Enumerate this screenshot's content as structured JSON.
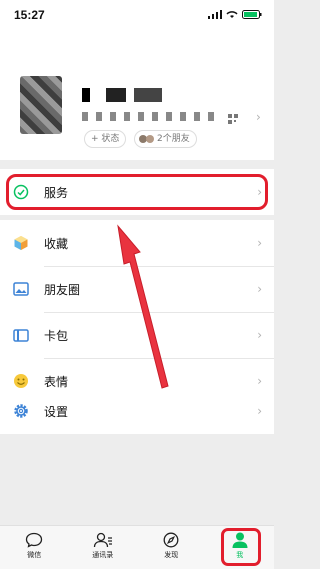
{
  "status_bar": {
    "time": "15:27"
  },
  "profile": {
    "status_button": "+ 状态",
    "friends_button": "2个朋友"
  },
  "menu": {
    "services": {
      "label": "服务",
      "icon": "services-icon"
    },
    "favorites": {
      "label": "收藏",
      "icon": "cube-icon"
    },
    "moments": {
      "label": "朋友圈",
      "icon": "image-icon"
    },
    "cards": {
      "label": "卡包",
      "icon": "wallet-icon"
    },
    "stickers": {
      "label": "表情",
      "icon": "smile-icon"
    },
    "settings": {
      "label": "设置",
      "icon": "gear-icon"
    }
  },
  "tabbar": {
    "chats": "微信",
    "contacts": "通讯录",
    "discover": "发现",
    "me": "我"
  },
  "colors": {
    "accent": "#07c160",
    "annotation": "#e21e2d"
  }
}
